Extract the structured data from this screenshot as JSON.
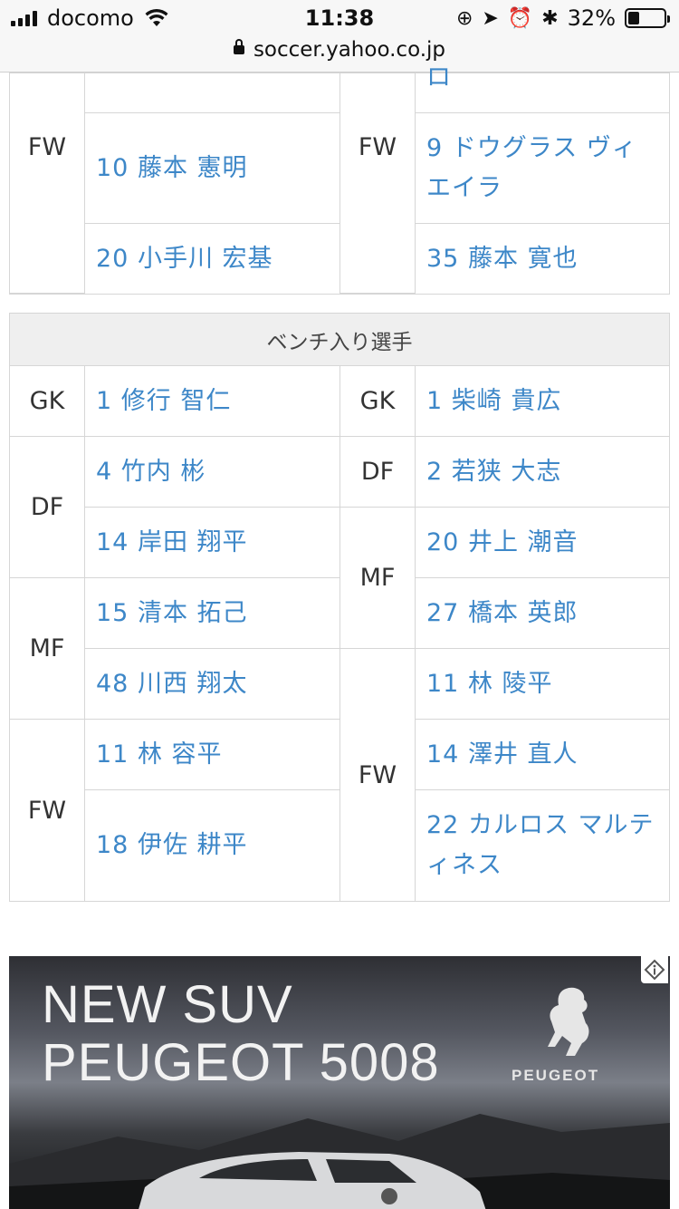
{
  "status_bar": {
    "carrier": "docomo",
    "time": "11:38",
    "battery_percent": "32%",
    "battery_level": 0.32,
    "icons": [
      "signal-icon",
      "wifi-icon",
      "rotation-lock-icon",
      "location-icon",
      "alarm-icon",
      "bluetooth-icon",
      "battery-icon"
    ]
  },
  "url_bar": {
    "url": "soccer.yahoo.co.jp"
  },
  "starting_table": {
    "home_prev_tail": "",
    "away_prev_tail": "ロ",
    "home_pos": "FW",
    "away_pos": "FW",
    "home_players": [
      "10 藤本 憲明",
      "20 小手川 宏基"
    ],
    "away_players": [
      "9 ドウグラス ヴィエイラ",
      "35 藤本 寛也"
    ]
  },
  "bench": {
    "title": "ベンチ入り選手",
    "home": [
      {
        "pos": "GK",
        "players": [
          "1 修行 智仁"
        ]
      },
      {
        "pos": "DF",
        "players": [
          "4 竹内 彬",
          "14 岸田 翔平"
        ]
      },
      {
        "pos": "MF",
        "players": [
          "15 清本 拓己",
          "48 川西 翔太"
        ]
      },
      {
        "pos": "FW",
        "players": [
          "11 林 容平",
          "18 伊佐 耕平"
        ]
      }
    ],
    "away": [
      {
        "pos": "GK",
        "players": [
          "1 柴崎 貴広"
        ]
      },
      {
        "pos": "DF",
        "players": [
          "2 若狭 大志"
        ]
      },
      {
        "pos": "MF",
        "players": [
          "20 井上 潮音",
          "27 橋本 英郎"
        ]
      },
      {
        "pos": "FW",
        "players": [
          "11 林 陵平",
          "14 澤井 直人",
          "22 カルロス マルティネス"
        ]
      }
    ]
  },
  "ad": {
    "headline_line1": "NEW SUV",
    "headline_line2": "PEUGEOT 5008",
    "brand": "PEUGEOT",
    "colors": {
      "text": "#f2f2f2",
      "sky": "#545760"
    }
  },
  "colors": {
    "link": "#3d87c8",
    "border": "#d6d6d6",
    "header_bg": "#efefef"
  }
}
